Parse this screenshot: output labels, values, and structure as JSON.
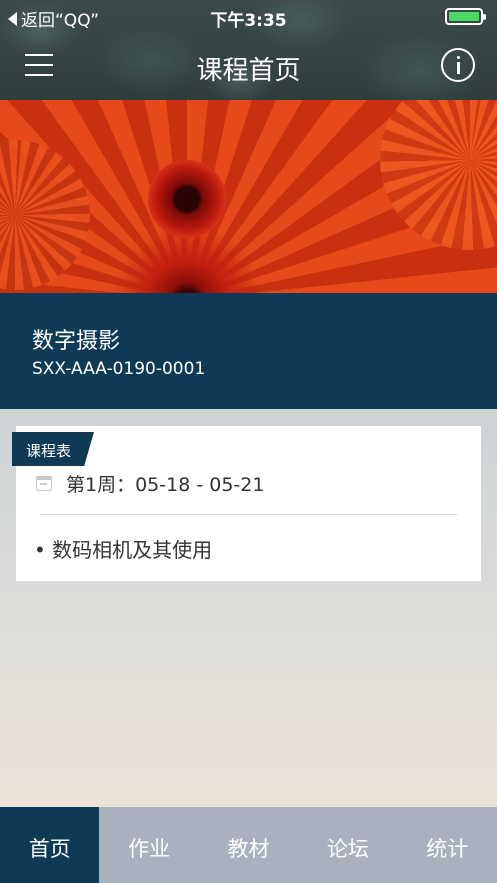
{
  "status_bar": {
    "back_label": "返回“QQ”",
    "time": "下午3:35",
    "battery_level": 1.0,
    "battery_color": "#4cd964"
  },
  "nav": {
    "title": "课程首页",
    "menu_icon": "hamburger-menu-icon",
    "info_icon": "info-circle-icon"
  },
  "course": {
    "name": "数字摄影",
    "code": "SXX-AAA-0190-0001"
  },
  "schedule": {
    "tag": "课程表",
    "week": "第1周：05-18 - 05-21",
    "topics": [
      "• 数码相机及其使用"
    ]
  },
  "tabs": [
    {
      "label": "首页",
      "active": true
    },
    {
      "label": "作业",
      "active": false
    },
    {
      "label": "教材",
      "active": false
    },
    {
      "label": "论坛",
      "active": false
    },
    {
      "label": "统计",
      "active": false
    }
  ],
  "colors": {
    "primary": "#0e3a55",
    "tab_bar": "#a8b1bd",
    "banner_accent": "#e64a1a"
  }
}
